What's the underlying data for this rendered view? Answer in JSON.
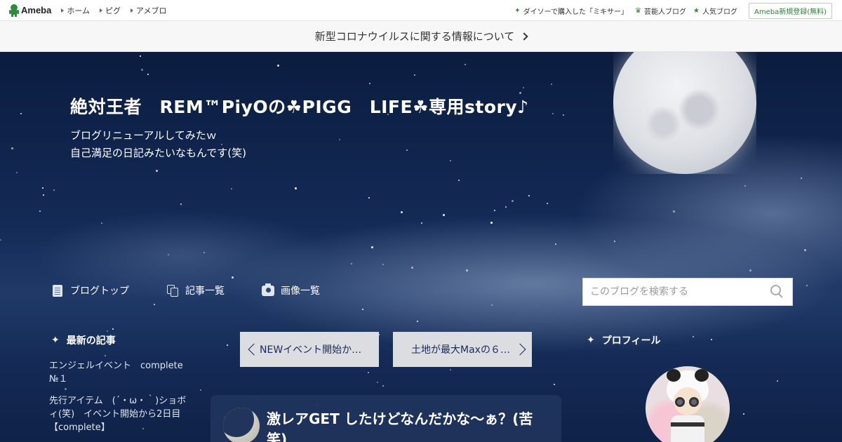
{
  "topbar": {
    "logo_text": "Ameba",
    "nav": [
      "ホーム",
      "ピグ",
      "アメブロ"
    ],
    "trending": "ダイソーで購入した「ミキサー」",
    "celebrity": "芸能人ブログ",
    "popular": "人気ブログ",
    "register": "Ameba新規登録(無料)"
  },
  "notice": {
    "text": "新型コロナウイルスに関する情報について"
  },
  "header": {
    "title": "絶対王者　REM™PiyOの☘PIGG　LIFE☘専用story♪",
    "desc_line1": "ブログリニューアルしてみたｗ",
    "desc_line2": "自己満足の日記みたいなもんです(笑)"
  },
  "blognav": {
    "top": "ブログトップ",
    "list": "記事一覧",
    "images": "画像一覧"
  },
  "search": {
    "placeholder": "このブログを検索する"
  },
  "recent": {
    "heading": "最新の記事",
    "items": [
      "エンジェルイベント　complete　№１",
      "先行アイテム　(´・ω・｀)ショボィ(笑)　イベント開始から2日目【complete】"
    ]
  },
  "pager": {
    "prev": "NEWイベント開始か…",
    "next": "土地が最大Maxの６…"
  },
  "article": {
    "title": "激レアGET したけどなんだかな～ぁ？(苦笑)"
  },
  "profile": {
    "heading": "プロフィール"
  },
  "colors": {
    "accent": "#2d8c3c",
    "sky": "#0d1f44",
    "card": "#20345c"
  }
}
